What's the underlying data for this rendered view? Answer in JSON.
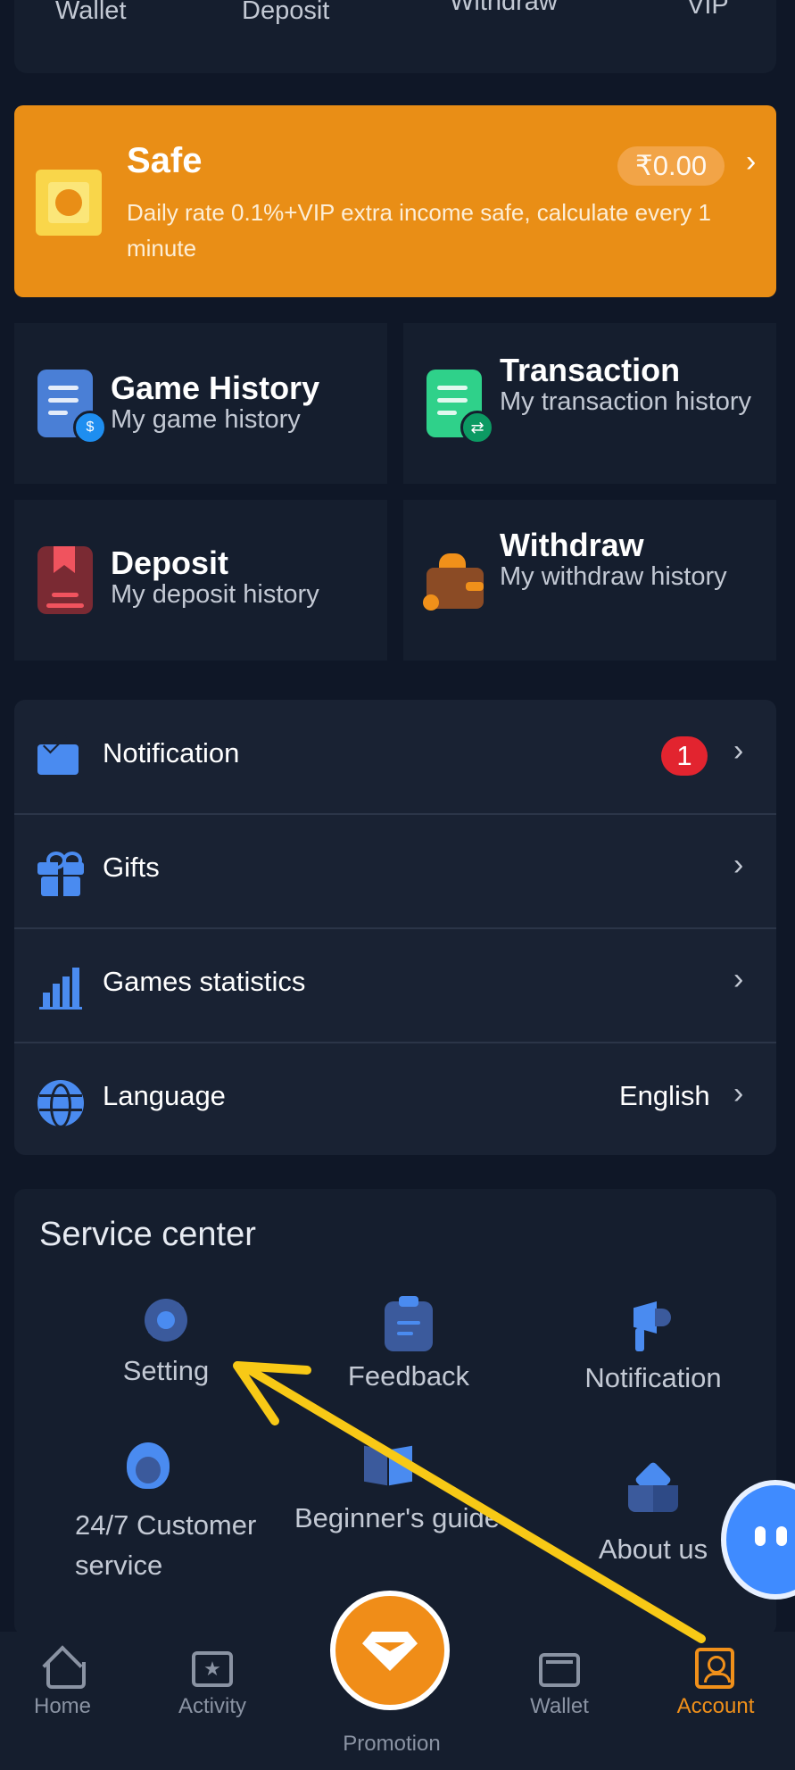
{
  "top_tabs": [
    "Wallet",
    "Deposit",
    "Withdraw",
    "VIP"
  ],
  "safe": {
    "title": "Safe",
    "amount": "₹0.00",
    "description": "Daily rate 0.1%+VIP extra income safe, calculate every 1 minute"
  },
  "history": [
    {
      "title": "Game History",
      "subtitle": "My game history"
    },
    {
      "title": "Transaction",
      "subtitle": "My transaction history"
    },
    {
      "title": "Deposit",
      "subtitle": "My deposit history"
    },
    {
      "title": "Withdraw",
      "subtitle": "My withdraw history"
    }
  ],
  "menu": {
    "notification": {
      "label": "Notification",
      "badge": "1"
    },
    "gifts": {
      "label": "Gifts"
    },
    "games_statistics": {
      "label": "Games statistics"
    },
    "language": {
      "label": "Language",
      "value": "English"
    }
  },
  "service_center": {
    "title": "Service center",
    "items": [
      "Setting",
      "Feedback",
      "Notification",
      "24/7 Customer service",
      "Beginner's guide",
      "About us"
    ]
  },
  "bottom_nav": [
    "Home",
    "Activity",
    "Promotion",
    "Wallet",
    "Account"
  ],
  "colors": {
    "accent": "#f0901a",
    "background": "#0f1727",
    "card": "#151e2e",
    "badge": "#e2242f",
    "annotation_arrow": "#f8c916"
  }
}
